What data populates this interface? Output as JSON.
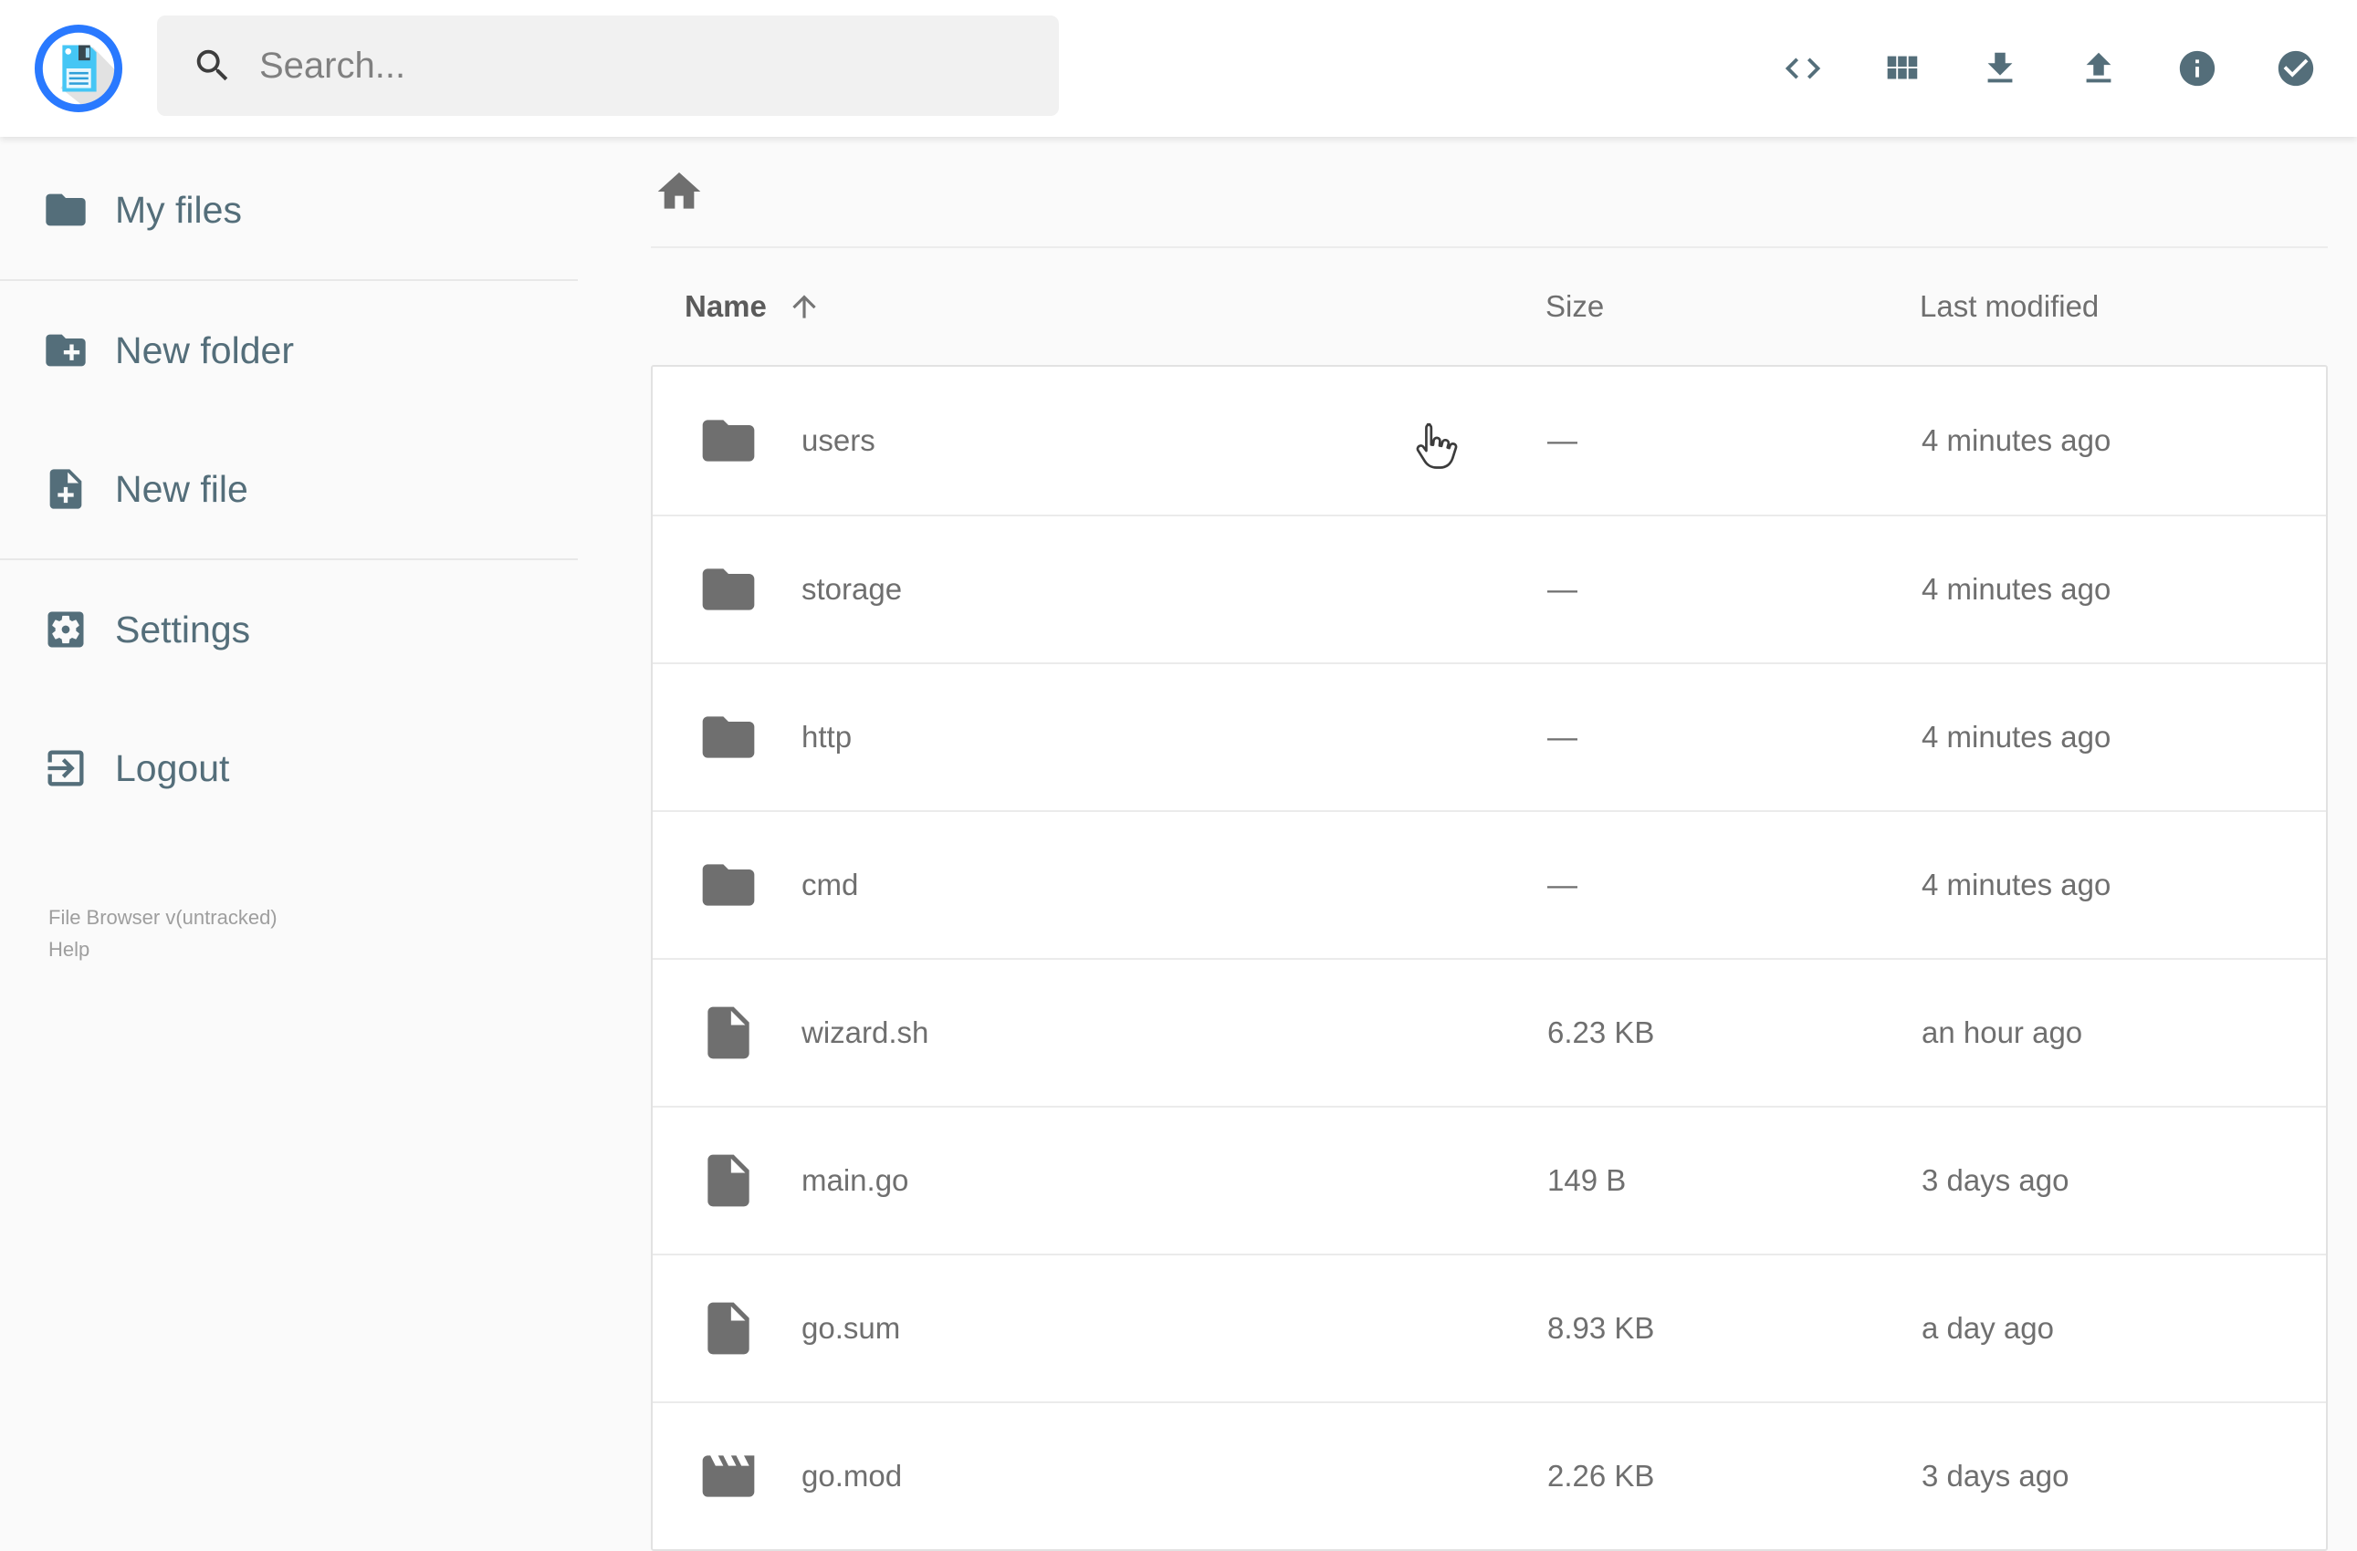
{
  "header": {
    "search": {
      "placeholder": "Search..."
    },
    "actions": [
      {
        "label": "toggle shell",
        "icon": "code-icon"
      },
      {
        "label": "switch view",
        "icon": "grid-view-icon"
      },
      {
        "label": "download",
        "icon": "download-icon"
      },
      {
        "label": "upload",
        "icon": "upload-icon"
      },
      {
        "label": "info",
        "icon": "info-icon"
      },
      {
        "label": "select multiple",
        "icon": "check-circle-icon"
      }
    ]
  },
  "sidebar": {
    "items": [
      {
        "label": "My files",
        "icon": "folder-icon"
      },
      {
        "label": "New folder",
        "icon": "new-folder-icon"
      },
      {
        "label": "New file",
        "icon": "new-file-icon"
      },
      {
        "label": "Settings",
        "icon": "settings-icon"
      },
      {
        "label": "Logout",
        "icon": "logout-icon"
      }
    ],
    "footer": {
      "version": "File Browser v(untracked)",
      "help": "Help"
    }
  },
  "listing": {
    "columns": {
      "name": "Name",
      "size": "Size",
      "modified": "Last modified"
    },
    "sort": {
      "column": "Name",
      "direction": "ascending"
    },
    "rows": [
      {
        "name": "users",
        "type": "folder",
        "icon": "folder-icon",
        "size": "—",
        "modified": "4 minutes ago"
      },
      {
        "name": "storage",
        "type": "folder",
        "icon": "folder-icon",
        "size": "—",
        "modified": "4 minutes ago"
      },
      {
        "name": "http",
        "type": "folder",
        "icon": "folder-icon",
        "size": "—",
        "modified": "4 minutes ago"
      },
      {
        "name": "cmd",
        "type": "folder",
        "icon": "folder-icon",
        "size": "—",
        "modified": "4 minutes ago"
      },
      {
        "name": "wizard.sh",
        "type": "file",
        "icon": "file-icon",
        "size": "6.23 KB",
        "modified": "an hour ago"
      },
      {
        "name": "main.go",
        "type": "file",
        "icon": "file-icon",
        "size": "149 B",
        "modified": "3 days ago"
      },
      {
        "name": "go.sum",
        "type": "file",
        "icon": "file-icon",
        "size": "8.93 KB",
        "modified": "a day ago"
      },
      {
        "name": "go.mod",
        "type": "file",
        "icon": "movie-icon",
        "size": "2.26 KB",
        "modified": "3 days ago"
      }
    ]
  },
  "colors": {
    "accent_slate": "#546e7a",
    "logo_blue": "#2979ff",
    "logo_floppy_blue": "#45c6f5",
    "text_gray": "#6f6f6f",
    "page_bg": "#fafafa",
    "surface": "#ffffff",
    "border": "#e2e2e2"
  }
}
